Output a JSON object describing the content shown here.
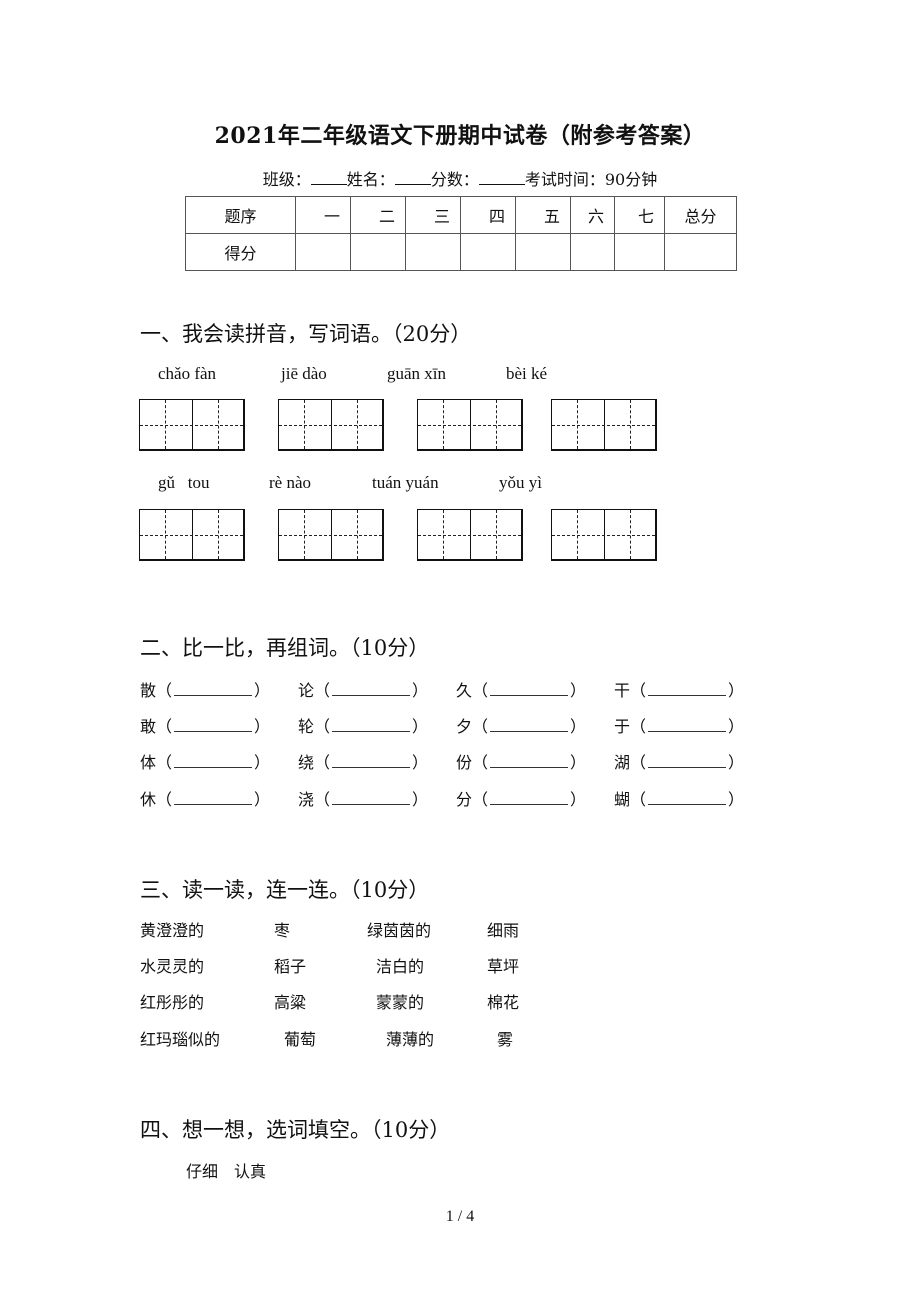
{
  "title": "2021年二年级语文下册期中试卷（附参考答案）",
  "info": {
    "class_label": "班级：",
    "name_label": "姓名：",
    "score_label": "分数：",
    "time_label": "考试时间：90分钟"
  },
  "score_table": {
    "header": [
      "题序",
      "一",
      "二",
      "三",
      "四",
      "五",
      "六",
      "七",
      "总分"
    ],
    "row_label": "得分"
  },
  "section1": {
    "heading": "一、我会读拼音，写词语。（20分）",
    "row1": [
      "chǎo fàn",
      "jiē dào",
      "guān xīn",
      "bèi ké"
    ],
    "row2": [
      "gǔ   tou",
      "rè nào",
      "tuán yuán",
      "yǒu yì"
    ]
  },
  "section2": {
    "heading": "二、比一比，再组词。（10分）",
    "rows": [
      [
        "散",
        "论",
        "久",
        "干"
      ],
      [
        "敢",
        "轮",
        "夕",
        "于"
      ],
      [
        "体",
        "绕",
        "份",
        "湖"
      ],
      [
        "休",
        "浇",
        "分",
        "蝴"
      ]
    ],
    "open_paren": "（",
    "close_paren": "）"
  },
  "section3": {
    "heading": "三、读一读，连一连。（10分）",
    "rows": [
      [
        "黄澄澄的",
        "枣",
        "绿茵茵的",
        "细雨"
      ],
      [
        "水灵灵的",
        "稻子",
        "洁白的",
        "草坪"
      ],
      [
        "红彤彤的",
        "高粱",
        "蒙蒙的",
        "棉花"
      ],
      [
        "红玛瑙似的",
        "葡萄",
        "薄薄的",
        "雾"
      ]
    ]
  },
  "section4": {
    "heading": "四、想一想，选词填空。（10分）",
    "words": "仔细　认真"
  },
  "footer": {
    "page": "1 / 4"
  }
}
